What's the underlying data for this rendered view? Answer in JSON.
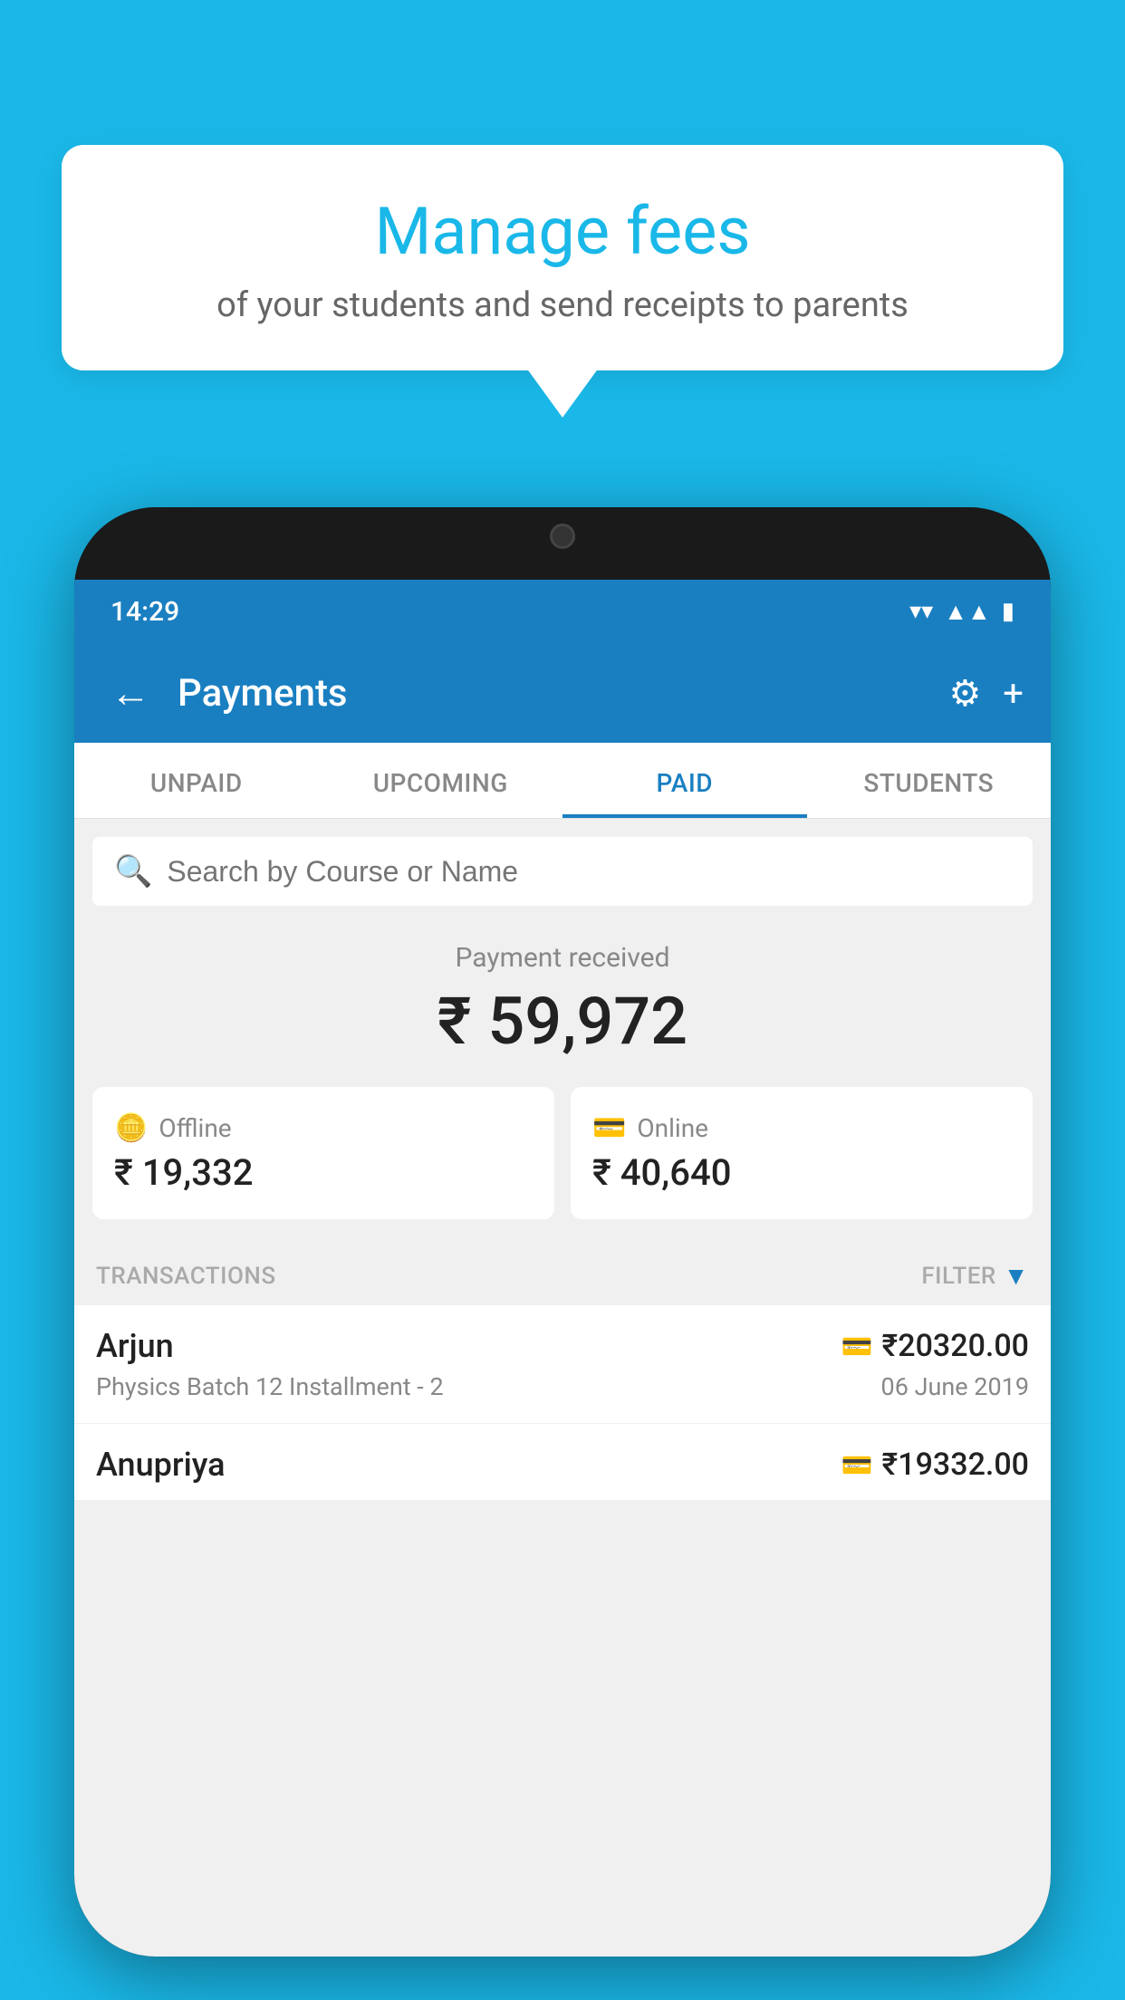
{
  "background_color": "#1ab8e8",
  "tooltip": {
    "title": "Manage fees",
    "subtitle": "of your students and send receipts to parents"
  },
  "status_bar": {
    "time": "14:29",
    "wifi_icon": "▲",
    "signal_icon": "▲",
    "battery_icon": "▮"
  },
  "app_bar": {
    "title": "Payments",
    "back_icon": "←",
    "settings_icon": "⚙",
    "add_icon": "+"
  },
  "tabs": [
    {
      "label": "UNPAID",
      "active": false
    },
    {
      "label": "UPCOMING",
      "active": false
    },
    {
      "label": "PAID",
      "active": true
    },
    {
      "label": "STUDENTS",
      "active": false
    }
  ],
  "search": {
    "placeholder": "Search by Course or Name"
  },
  "payment_summary": {
    "label": "Payment received",
    "amount": "₹ 59,972"
  },
  "payment_cards": [
    {
      "icon": "💳",
      "label": "Offline",
      "amount": "₹ 19,332"
    },
    {
      "icon": "💳",
      "label": "Online",
      "amount": "₹ 40,640"
    }
  ],
  "transactions": {
    "label": "TRANSACTIONS",
    "filter_label": "FILTER",
    "rows": [
      {
        "name": "Arjun",
        "type_icon": "💳",
        "amount": "₹20320.00",
        "description": "Physics Batch 12 Installment - 2",
        "date": "06 June 2019"
      },
      {
        "name": "Anupriya",
        "type_icon": "💳",
        "amount": "₹19332.00",
        "description": "",
        "date": ""
      }
    ]
  }
}
